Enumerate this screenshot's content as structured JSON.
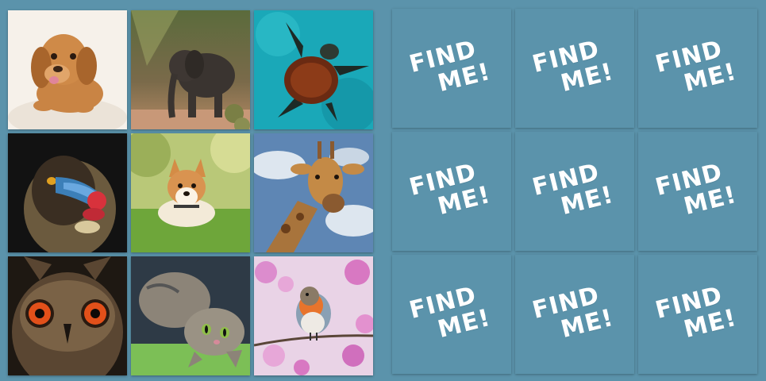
{
  "board": {
    "revealed_tiles": [
      {
        "animal": "puppy"
      },
      {
        "animal": "elephant"
      },
      {
        "animal": "sea-turtle"
      },
      {
        "animal": "mandrill"
      },
      {
        "animal": "corgi"
      },
      {
        "animal": "giraffe"
      },
      {
        "animal": "owl"
      },
      {
        "animal": "cat"
      },
      {
        "animal": "robin"
      }
    ],
    "hidden_cards": [
      {
        "line1": "FIND",
        "line2": "ME!"
      },
      {
        "line1": "FIND",
        "line2": "ME!"
      },
      {
        "line1": "FIND",
        "line2": "ME!"
      },
      {
        "line1": "FIND",
        "line2": "ME!"
      },
      {
        "line1": "FIND",
        "line2": "ME!"
      },
      {
        "line1": "FIND",
        "line2": "ME!"
      },
      {
        "line1": "FIND",
        "line2": "ME!"
      },
      {
        "line1": "FIND",
        "line2": "ME!"
      },
      {
        "line1": "FIND",
        "line2": "ME!"
      }
    ]
  },
  "colors": {
    "background": "#5b93ab",
    "card_text": "#ffffff"
  }
}
